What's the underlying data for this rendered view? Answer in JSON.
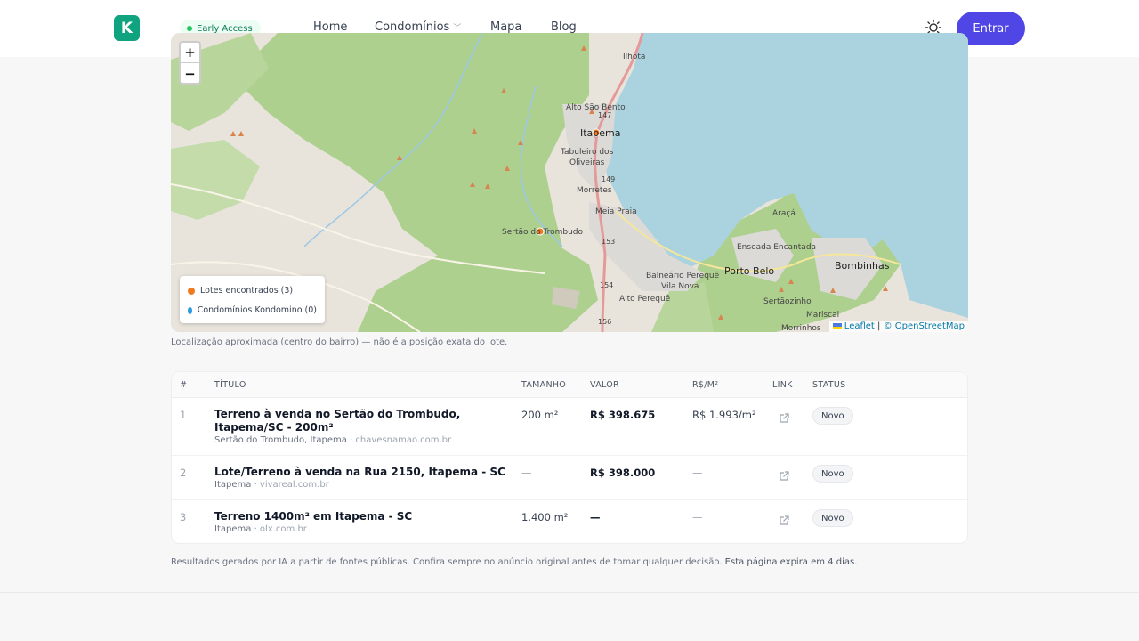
{
  "header": {
    "logo_letter": "K",
    "early_access": "Early Access",
    "nav": [
      {
        "label": "Home"
      },
      {
        "label": "Condomínios",
        "has_dropdown": true
      },
      {
        "label": "Mapa"
      },
      {
        "label": "Blog"
      }
    ],
    "entrar_label": "Entrar",
    "accent_color": "#4f46e5",
    "brand_color": "#10a37f"
  },
  "map": {
    "zoom_in": "+",
    "zoom_out": "−",
    "places": {
      "ilhota": "Ilhota",
      "alto_sao_bento": "Alto São Bento",
      "itapema": "Itapema",
      "tabuleiro": "Tabuleiro dos",
      "tabuleiro2": "Oliveiras",
      "morretes": "Morretes",
      "meia_praia": "Meia Praia",
      "sertao": "Sertão do Trombudo",
      "araca": "Araçá",
      "enseada": "Enseada Encantada",
      "porto_belo": "Porto Belo",
      "bombinhas": "Bombinhas",
      "balneario": "Balneário Perequê",
      "vila_nova": "Vila Nova",
      "alto_pereque": "Alto Perequê",
      "sertaozinho": "Sertãozinho",
      "mariscal": "Mariscal",
      "morrinhos": "Morrinhos",
      "r147": "147",
      "r149": "149",
      "r153": "153",
      "r154": "154",
      "r156": "156"
    },
    "legend": [
      {
        "label": "Lotes encontrados (3)",
        "color": "#f07a1f"
      },
      {
        "label": "Condomínios Kondomino (0)",
        "color": "#2b9ae0"
      }
    ],
    "attribution": {
      "leaflet": "Leaflet",
      "sep": "|",
      "osm": "© OpenStreetMap"
    }
  },
  "map_note": "Localização aproximada (centro do bairro) — não é a posição exata do lote.",
  "table": {
    "headers": [
      "#",
      "TÍTULO",
      "TAMANHO",
      "VALOR",
      "R$/M²",
      "LINK",
      "STATUS"
    ],
    "rows": [
      {
        "num": "1",
        "title": "Terreno à venda no Sertão do Trombudo, Itapema/SC - 200m²",
        "location": "Sertão do Trombudo, Itapema",
        "source": "· chavesnamao.com.br",
        "size": "200 m²",
        "value": "R$ 398.675",
        "per_m2": "R$ 1.993/m²",
        "status": "Novo"
      },
      {
        "num": "2",
        "title": "Lote/Terreno à venda na Rua 2150, Itapema - SC",
        "location": "Itapema",
        "source": "· vivareal.com.br",
        "size": "—",
        "value": "R$ 398.000",
        "per_m2": "—",
        "status": "Novo"
      },
      {
        "num": "3",
        "title": "Terreno 1400m² em Itapema - SC",
        "location": "Itapema",
        "source": "· olx.com.br",
        "size": "1.400 m²",
        "value": "—",
        "per_m2": "—",
        "status": "Novo"
      }
    ]
  },
  "footer": {
    "note": "Resultados gerados por IA a partir de fontes públicas. Confira sempre no anúncio original antes de tomar qualquer decisão.",
    "expires": "Esta página expira em 4 dias."
  }
}
